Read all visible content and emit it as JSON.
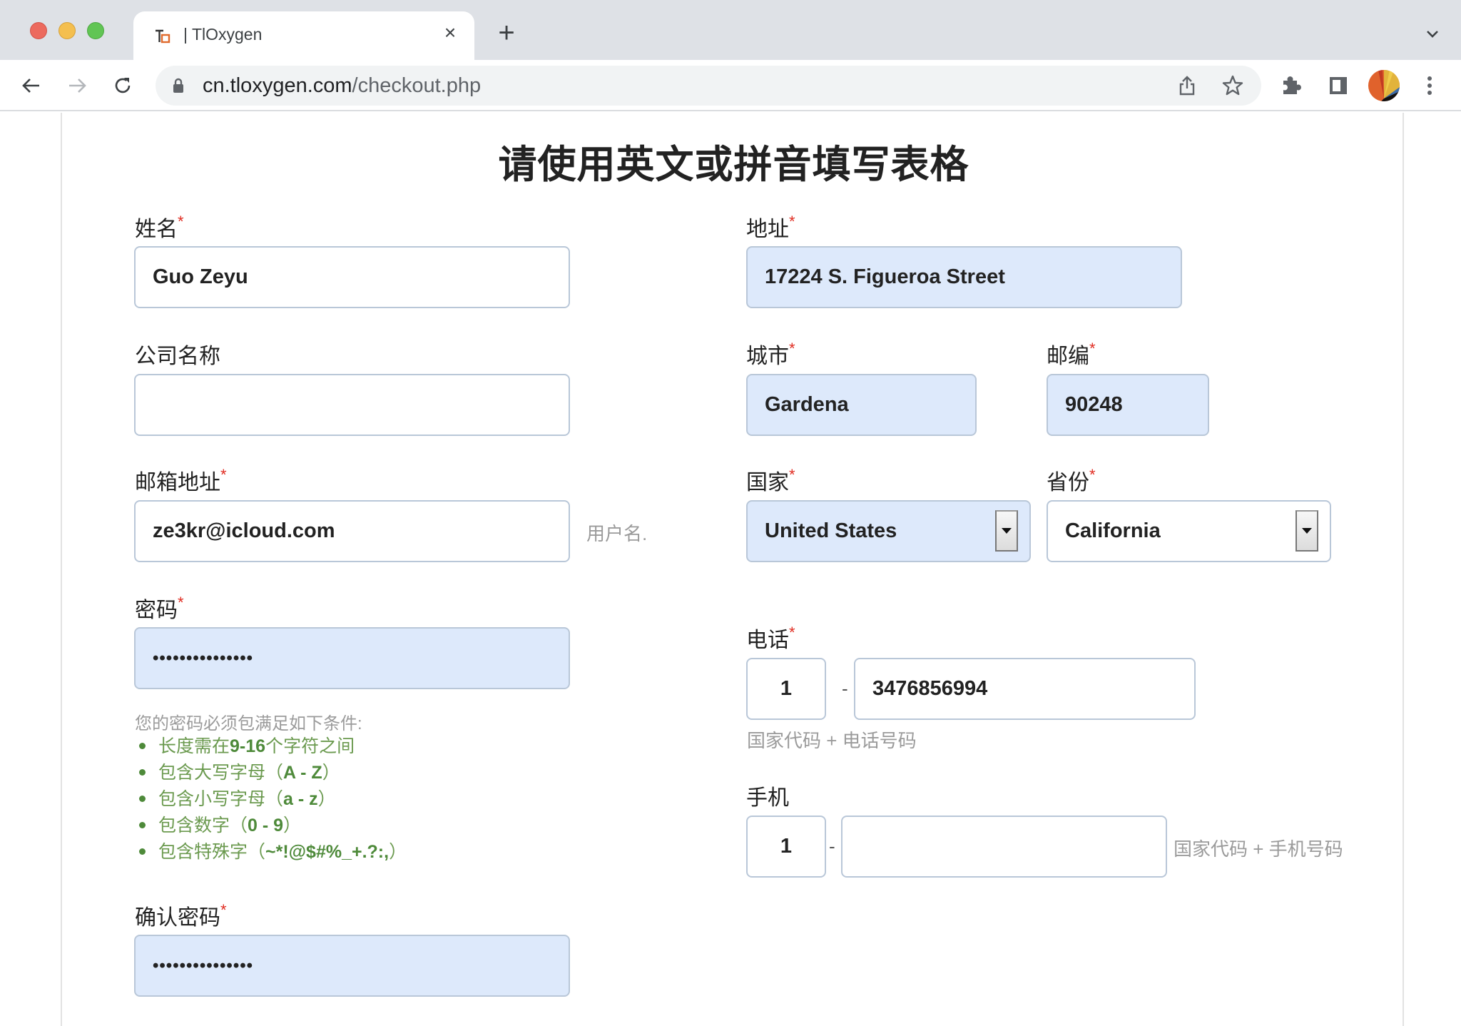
{
  "browser": {
    "tab_title": "| TlOxygen",
    "tab_close": "×",
    "new_tab": "+",
    "url_host": "cn.tloxygen.com",
    "url_path": "/checkout.php"
  },
  "page": {
    "title": "请使用英文或拼音填写表格",
    "required_mark": "*",
    "left": {
      "name": {
        "label": "姓名",
        "required": true,
        "value": "Guo Zeyu"
      },
      "company": {
        "label": "公司名称",
        "required": false,
        "value": ""
      },
      "email": {
        "label": "邮箱地址",
        "required": true,
        "value": "ze3kr@icloud.com",
        "hint": "用户名."
      },
      "password": {
        "label": "密码",
        "required": true,
        "value_masked": "•••••••••••••••"
      },
      "password_rules": {
        "title": "您的密码必须包满足如下条件:",
        "items": [
          {
            "prefix": "长度需在",
            "bold": "9-16",
            "suffix": "个字符之间"
          },
          {
            "prefix": "包含大写字母（",
            "bold": "A - Z",
            "suffix": "）"
          },
          {
            "prefix": "包含小写字母（",
            "bold": "a - z",
            "suffix": "）"
          },
          {
            "prefix": "包含数字（",
            "bold": "0 - 9",
            "suffix": "）"
          },
          {
            "prefix": "包含特殊字（",
            "bold": "~*!@$#%_+.?:,",
            "suffix": "）"
          }
        ]
      },
      "confirm_password": {
        "label": "确认密码",
        "required": true,
        "value_masked": "•••••••••••••••"
      }
    },
    "right": {
      "address": {
        "label": "地址",
        "required": true,
        "value": "17224 S. Figueroa Street"
      },
      "city": {
        "label": "城市",
        "required": true,
        "value": "Gardena"
      },
      "zip": {
        "label": "邮编",
        "required": true,
        "value": "90248"
      },
      "country": {
        "label": "国家",
        "required": true,
        "selected": "United States"
      },
      "province": {
        "label": "省份",
        "required": true,
        "selected": "California"
      },
      "phone": {
        "label": "电话",
        "required": true,
        "country_code": "1",
        "separator": "-",
        "number": "3476856994",
        "hint": "国家代码 + 电话号码"
      },
      "mobile": {
        "label": "手机",
        "required": false,
        "country_code": "1",
        "separator": "-",
        "number": "",
        "hint": "国家代码 + 手机号码"
      }
    }
  },
  "colors": {
    "required": "#e02b20",
    "autofill_bg": "#dde9fb",
    "rule_green": "#6b9a4f",
    "field_border": "#b9c7d8"
  }
}
